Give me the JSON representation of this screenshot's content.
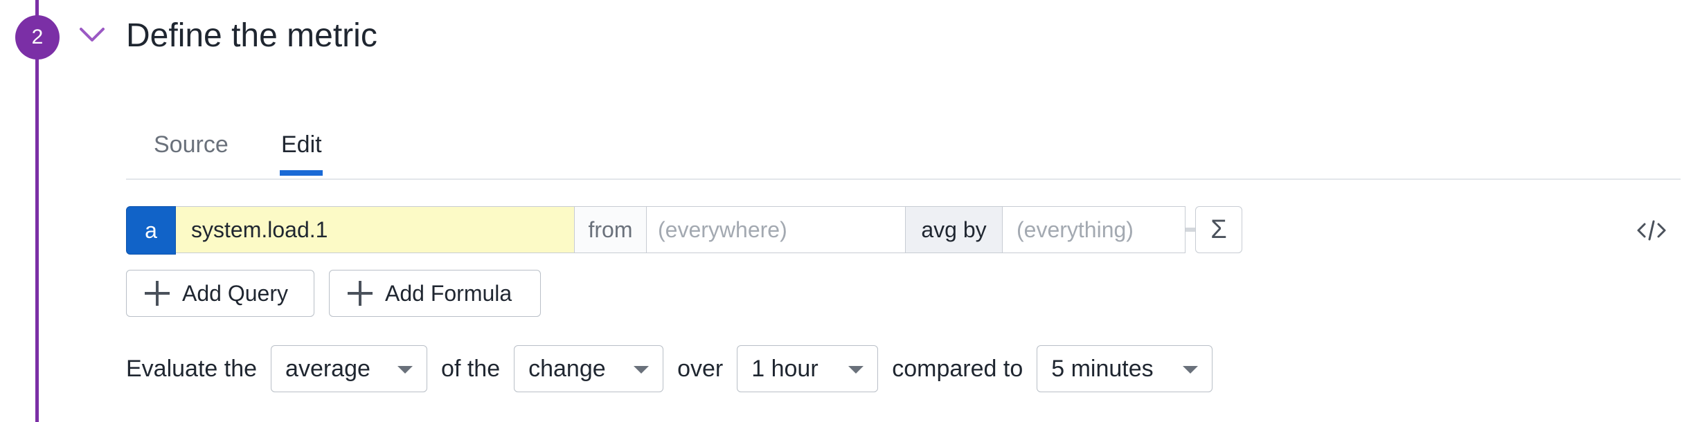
{
  "step": {
    "number": "2",
    "title": "Define the metric"
  },
  "tabs": [
    {
      "label": "Source"
    },
    {
      "label": "Edit"
    }
  ],
  "query": {
    "letter": "a",
    "metric": "system.load.1",
    "from_label": "from",
    "from_placeholder": "(everywhere)",
    "aggregator": "avg by",
    "by_placeholder": "(everything)",
    "sigma": "Σ"
  },
  "buttons": {
    "add_query": "Add Query",
    "add_formula": "Add Formula"
  },
  "evaluate": {
    "prefix": "Evaluate the",
    "aggregation": "average",
    "of_the": "of the",
    "type": "change",
    "over": "over",
    "window": "1 hour",
    "compared_to": "compared to",
    "compare_window": "5 minutes"
  },
  "colors": {
    "step_accent": "#7b2fa6",
    "query_letter_bg": "#1163c8",
    "metric_bg": "#fcfac6",
    "tab_active": "#1a6ad6"
  },
  "icons": {
    "collapse": "chevron-down-icon",
    "sigma": "sigma-icon",
    "code": "code-icon",
    "add": "plus-icon",
    "dropdown": "caret-down-icon"
  }
}
